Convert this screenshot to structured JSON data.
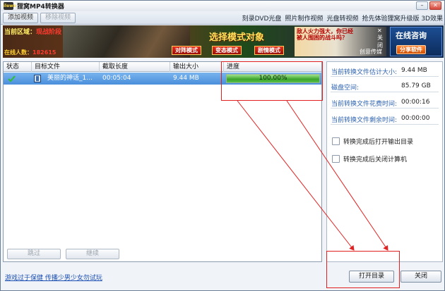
{
  "window": {
    "title": "狸窝MP4转换器",
    "logo_text": "ilewo",
    "minimize": "–",
    "close": "✕"
  },
  "toolbar": {
    "add_video": "添加视频",
    "remove_video": "移除视频",
    "links": [
      "刻录DVD光盘",
      "照片制作视频",
      "光盘转视频",
      "抢先体验狸窝升级版 3D效果"
    ]
  },
  "banner": {
    "area_label": "当前区域：",
    "area_value": "现战阶段",
    "online_label": "在线人数：",
    "online_value": "182615",
    "headline": "选择模式对象",
    "modes": [
      "对阵模式",
      "变态模式",
      "剧情模式"
    ],
    "ad_text": "敌人火力强大，你已经被人围困的战斗吗？",
    "ad_close": "✕ 关闭",
    "ad_brand": "创意传媒",
    "consult": "在线咨询",
    "share": "分享软件"
  },
  "table": {
    "columns": [
      "状态",
      "目标文件",
      "截取长度",
      "输出大小",
      "进度"
    ],
    "rows": [
      {
        "status_icon": "check-icon",
        "file_icon": "film-icon",
        "file_name": "美丽的神话_1...",
        "duration": "00:05:04",
        "size": "9.44 MB",
        "progress": 1.0,
        "progress_text": "100.00%"
      }
    ],
    "skip_button": "跳过",
    "continue_button": "继续"
  },
  "panel": {
    "stats": [
      {
        "label": "当前转换文件估计大小:",
        "value": "9.44 MB"
      },
      {
        "label": "磁盘空间:",
        "value": "85.79 GB"
      },
      {
        "label": "当前转换文件花费时间:",
        "value": "00:00:16"
      },
      {
        "label": "当前转换文件剩余时间:",
        "value": "00:00:00"
      }
    ],
    "options": [
      {
        "label": "转换完成后打开输出目录",
        "checked": false
      },
      {
        "label": "转换完成后关闭计算机",
        "checked": false
      }
    ]
  },
  "footer": {
    "link": "游戏过于保健 传播少男少女勿试玩",
    "open_dir": "打开目录",
    "close": "关闭"
  },
  "colors": {
    "annotation": "#e32020",
    "selection": "#4a8fdb",
    "progress": "#3aa42b",
    "link": "#1c4fb3"
  }
}
